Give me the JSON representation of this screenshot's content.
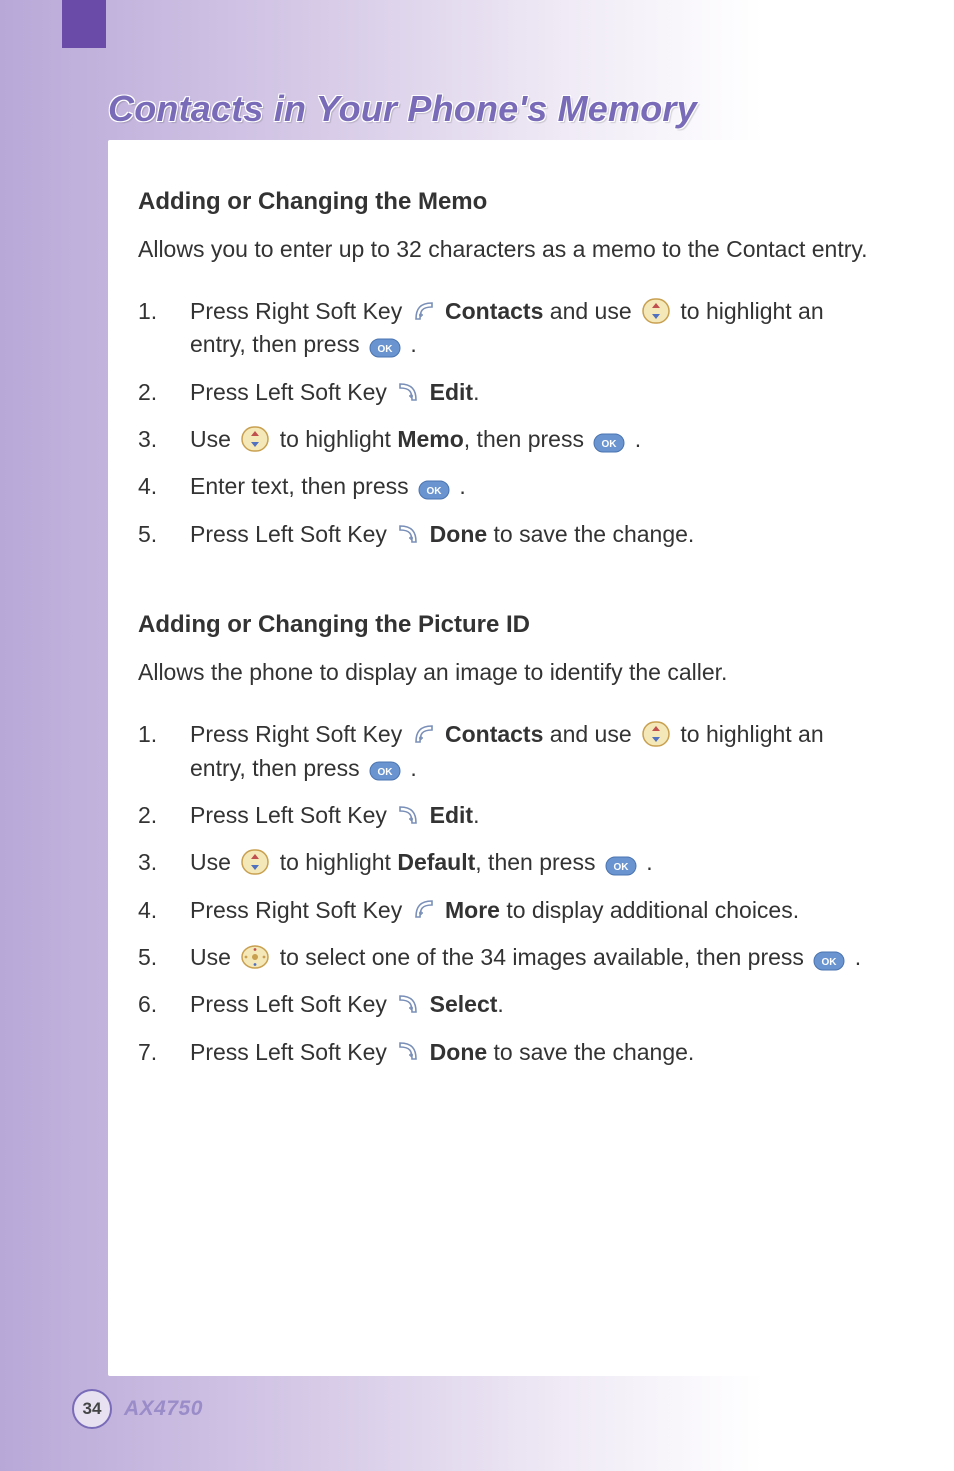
{
  "page": {
    "chapter_title": "Contacts in Your Phone's Memory",
    "page_number": "34",
    "model": "AX4750"
  },
  "section1": {
    "heading": "Adding or Changing the Memo",
    "intro": "Allows you to enter up to 32 characters as a memo to the Contact entry.",
    "steps": {
      "s1_a": "Press Right Soft Key ",
      "s1_b": "Contacts",
      "s1_c": " and use ",
      "s1_d": " to highlight an entry, then press ",
      "s1_e": ".",
      "s2_a": "Press Left Soft Key ",
      "s2_b": "Edit",
      "s2_c": ".",
      "s3_a": "Use ",
      "s3_b": " to highlight ",
      "s3_c": "Memo",
      "s3_d": ", then press ",
      "s3_e": ".",
      "s4_a": "Enter text, then press ",
      "s4_b": ".",
      "s5_a": "Press Left Soft Key ",
      "s5_b": "Done",
      "s5_c": " to save the change."
    }
  },
  "section2": {
    "heading": "Adding or Changing the Picture ID",
    "intro": "Allows the phone to display an image to identify the caller.",
    "steps": {
      "s1_a": "Press Right Soft Key ",
      "s1_b": "Contacts",
      "s1_c": " and use ",
      "s1_d": " to highlight an entry, then press ",
      "s1_e": ".",
      "s2_a": "Press Left Soft Key ",
      "s2_b": "Edit",
      "s2_c": ".",
      "s3_a": "Use ",
      "s3_b": " to highlight ",
      "s3_c": "Default",
      "s3_d": ", then press ",
      "s3_e": ".",
      "s4_a": "Press Right Soft Key ",
      "s4_b": "More",
      "s4_c": " to display additional choices.",
      "s5_a": "Use ",
      "s5_b": " to select one of the 34 images available, then press ",
      "s5_c": ".",
      "s6_a": "Press Left Soft Key ",
      "s6_b": "Select",
      "s6_c": ".",
      "s7_a": "Press Left Soft Key ",
      "s7_b": "Done",
      "s7_c": " to save the change."
    }
  }
}
